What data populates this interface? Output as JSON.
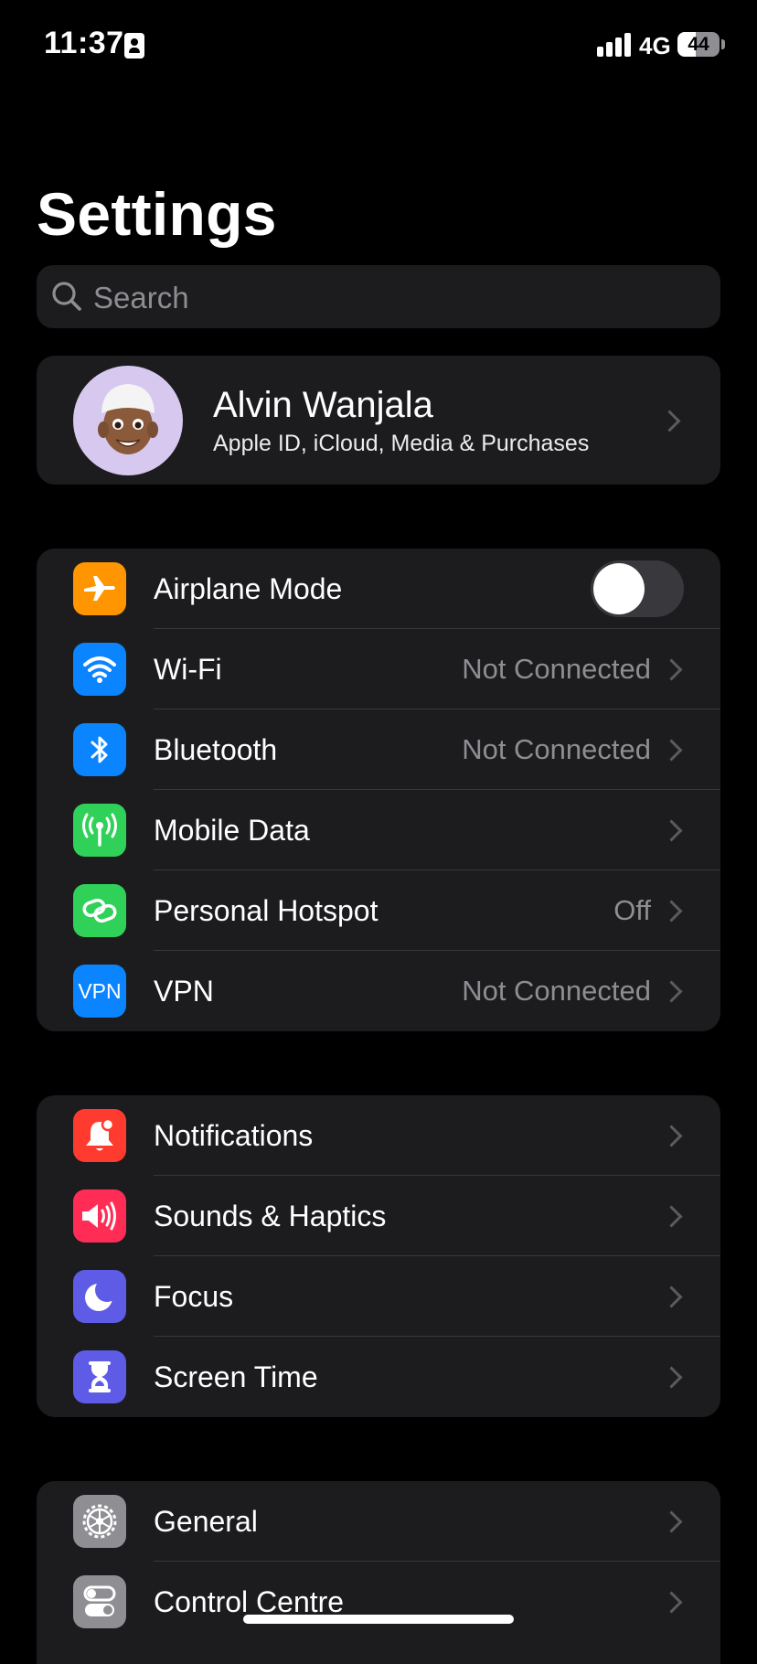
{
  "status_bar": {
    "time": "11:37",
    "network": "4G",
    "battery_percent": "44",
    "battery_level": 0.44
  },
  "page": {
    "title": "Settings"
  },
  "search": {
    "placeholder": "Search"
  },
  "profile": {
    "name": "Alvin Wanjala",
    "subtitle": "Apple ID, iCloud, Media & Purchases"
  },
  "groups": [
    [
      {
        "id": "airplane-mode",
        "label": "Airplane Mode",
        "icon": "airplane-icon",
        "color": "#ff9500",
        "toggle": false
      },
      {
        "id": "wifi",
        "label": "Wi-Fi",
        "value": "Not Connected",
        "icon": "wifi-icon",
        "color": "#0a84ff"
      },
      {
        "id": "bluetooth",
        "label": "Bluetooth",
        "value": "Not Connected",
        "icon": "bluetooth-icon",
        "color": "#0a84ff"
      },
      {
        "id": "mobile-data",
        "label": "Mobile Data",
        "icon": "antenna-icon",
        "color": "#30d158"
      },
      {
        "id": "personal-hotspot",
        "label": "Personal Hotspot",
        "value": "Off",
        "icon": "hotspot-icon",
        "color": "#30d158"
      },
      {
        "id": "vpn",
        "label": "VPN",
        "value": "Not Connected",
        "icon": "vpn-icon",
        "icon_text": "VPN",
        "color": "#0a84ff"
      }
    ],
    [
      {
        "id": "notifications",
        "label": "Notifications",
        "icon": "bell-icon",
        "color": "#ff3b30"
      },
      {
        "id": "sounds-haptics",
        "label": "Sounds & Haptics",
        "icon": "speaker-icon",
        "color": "#ff2d55"
      },
      {
        "id": "focus",
        "label": "Focus",
        "icon": "moon-icon",
        "color": "#5e5ce6"
      },
      {
        "id": "screen-time",
        "label": "Screen Time",
        "icon": "hourglass-icon",
        "color": "#5e5ce6"
      }
    ],
    [
      {
        "id": "general",
        "label": "General",
        "icon": "gear-icon",
        "color": "#8e8e93"
      },
      {
        "id": "control-centre",
        "label": "Control Centre",
        "icon": "toggles-icon",
        "color": "#8e8e93"
      }
    ]
  ]
}
